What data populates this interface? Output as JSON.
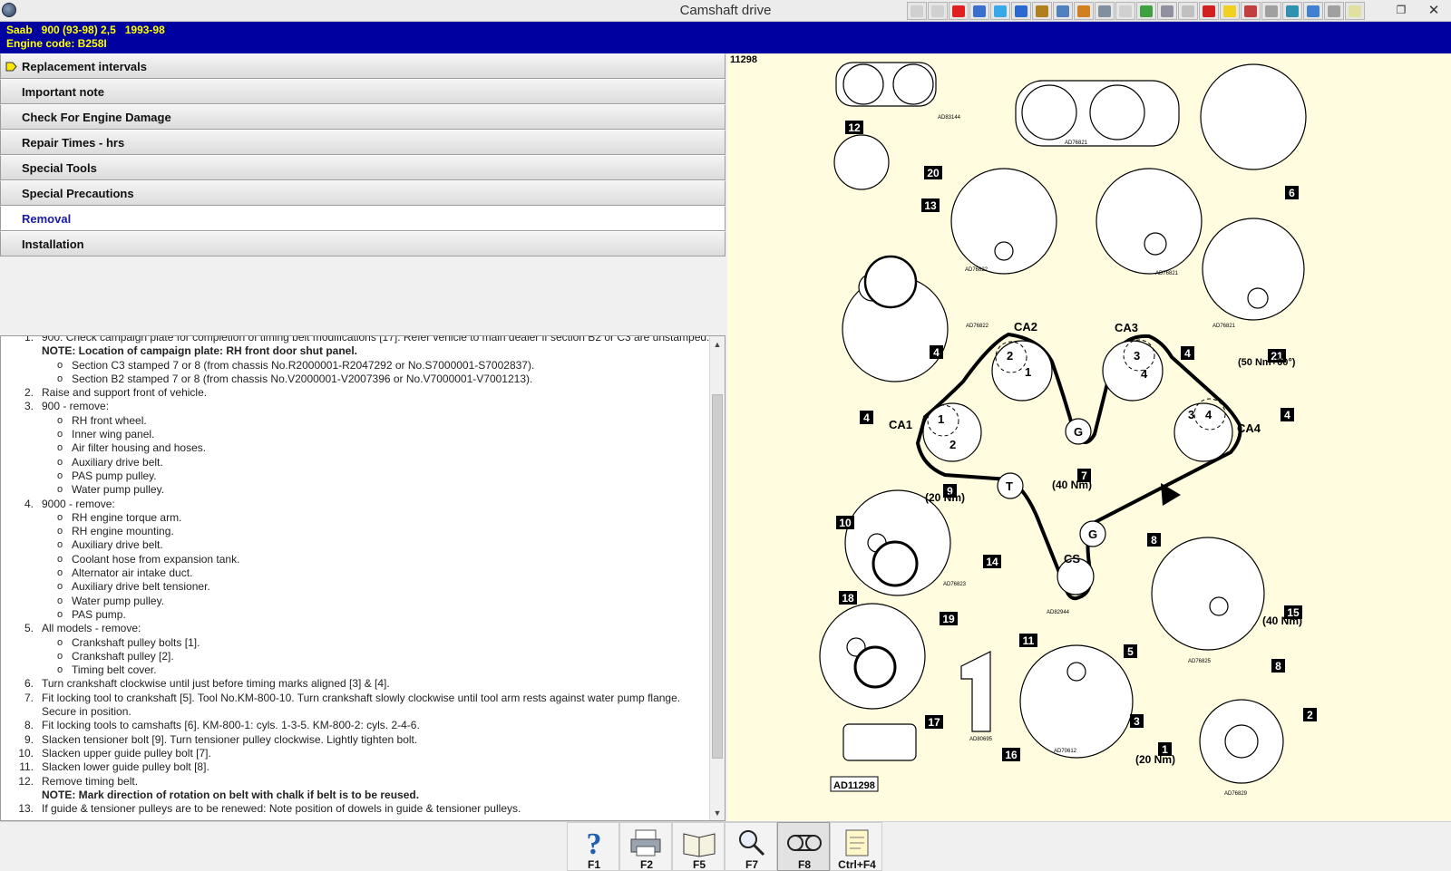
{
  "window": {
    "title": "Camshaft drive",
    "restore": "❐",
    "close": "✕"
  },
  "toolbar": {
    "icons": [
      "first-icon",
      "prev-icon",
      "warning-icon",
      "book-icon",
      "chart-icon",
      "gear-icon",
      "tool-icon",
      "circle-icon",
      "bell-icon",
      "wrench-icon",
      "car-icon",
      "engine-icon",
      "key-icon",
      "battery-icon",
      "photo-icon",
      "light-icon",
      "calendar-icon",
      "star-icon",
      "print-icon",
      "rocket-icon",
      "brake-icon",
      "page-icon"
    ]
  },
  "vehicle": {
    "line1": "Saab   900 (93-98) 2,5   1993-98",
    "line2": "Engine code: B258I"
  },
  "nav": [
    {
      "label": "Replacement intervals"
    },
    {
      "label": "Important note"
    },
    {
      "label": "Check For Engine Damage"
    },
    {
      "label": "Repair Times - hrs"
    },
    {
      "label": "Special Tools"
    },
    {
      "label": "Special Precautions"
    },
    {
      "label": "Removal"
    },
    {
      "label": "Installation"
    }
  ],
  "steps": [
    {
      "num": "1.",
      "text": "900: Check campaign plate for completion of timing belt modifications [17]. Refer vehicle to main dealer if section B2 or C3 are unstamped."
    },
    {
      "note": "NOTE: Location of campaign plate: RH front door shut panel."
    },
    {
      "sub": "Section C3 stamped 7 or 8 (from chassis No.R2000001-R2047292 or No.S7000001-S7002837)."
    },
    {
      "sub": "Section B2 stamped 7 or 8 (from chassis No.V2000001-V2007396 or No.V7000001-V7001213)."
    },
    {
      "num": "2.",
      "text": "Raise and support front of vehicle."
    },
    {
      "num": "3.",
      "text": "900 - remove:"
    },
    {
      "sub": "RH front wheel."
    },
    {
      "sub": "Inner wing panel."
    },
    {
      "sub": "Air filter housing and hoses."
    },
    {
      "sub": "Auxiliary drive belt."
    },
    {
      "sub": "PAS pump pulley."
    },
    {
      "sub": "Water pump pulley."
    },
    {
      "num": "4.",
      "text": "9000 - remove:"
    },
    {
      "sub": "RH engine torque arm."
    },
    {
      "sub": "RH engine mounting."
    },
    {
      "sub": "Auxiliary drive belt."
    },
    {
      "sub": "Coolant hose from expansion tank."
    },
    {
      "sub": "Alternator air intake duct."
    },
    {
      "sub": "Auxiliary drive belt tensioner."
    },
    {
      "sub": "Water pump pulley."
    },
    {
      "sub": "PAS pump."
    },
    {
      "num": "5.",
      "text": "All models - remove:"
    },
    {
      "sub": "Crankshaft pulley bolts [1]."
    },
    {
      "sub": "Crankshaft pulley [2]."
    },
    {
      "sub": "Timing belt cover."
    },
    {
      "num": "6.",
      "text": "Turn crankshaft clockwise until just before timing marks aligned [3] & [4]."
    },
    {
      "num": "7.",
      "text": "Fit locking tool to crankshaft [5]. Tool No.KM-800-10. Turn crankshaft slowly clockwise until tool arm rests against water pump flange. Secure in position."
    },
    {
      "num": "8.",
      "text": "Fit locking tools to camshafts [6]. KM-800-1: cyls. 1-3-5. KM-800-2: cyls. 2-4-6."
    },
    {
      "num": "9.",
      "text": "Slacken tensioner bolt [9]. Turn tensioner pulley clockwise. Lightly tighten bolt."
    },
    {
      "num": "10.",
      "text": "Slacken upper guide pulley bolt [7]."
    },
    {
      "num": "11.",
      "text": "Slacken lower guide pulley bolt [8]."
    },
    {
      "num": "12.",
      "text": "Remove timing belt."
    },
    {
      "note": "NOTE: Mark direction of rotation on belt with chalk if belt is to be reused."
    },
    {
      "num": "13.",
      "text": "If guide & tensioner pulleys are to be renewed: Note position of dowels in guide & tensioner pulleys."
    }
  ],
  "scroll": {
    "up": "▲",
    "down": "▼"
  },
  "diagram": {
    "id": "11298",
    "ref": "AD11298",
    "pulleys": {
      "ca1": "CA1",
      "ca2": "CA2",
      "ca3": "CA3",
      "ca4": "CA4",
      "cs": "CS",
      "g": "G",
      "t": "T"
    },
    "callouts": [
      "1",
      "2",
      "3",
      "4",
      "5",
      "6",
      "7",
      "8",
      "9",
      "10",
      "11",
      "12",
      "13",
      "14",
      "15",
      "16",
      "17",
      "18",
      "19",
      "20",
      "21"
    ],
    "torques": {
      "t7": "(40 Nm)",
      "t9": "(20 Nm)",
      "t15": "(40 Nm)",
      "t1": "(20 Nm)",
      "t21": "(50 Nm+60°)"
    },
    "codes": [
      "AD83144",
      "AD76821",
      "AD76822",
      "AD76821",
      "AD76822",
      "AD76821",
      "AD76823",
      "AD82944",
      "AD76825",
      "AD70612",
      "AD80695",
      "AD76829"
    ],
    "marks": {
      "m1": "1",
      "m2": "2",
      "m3": "3",
      "m4": "4"
    }
  },
  "fkeys": [
    {
      "key": "F1",
      "icon": "help-icon"
    },
    {
      "key": "F2",
      "icon": "print-icon"
    },
    {
      "key": "F5",
      "icon": "book-icon"
    },
    {
      "key": "F7",
      "icon": "zoom-icon"
    },
    {
      "key": "F8",
      "icon": "belt-icon"
    },
    {
      "key": "Ctrl+F4",
      "icon": "notes-icon"
    }
  ]
}
